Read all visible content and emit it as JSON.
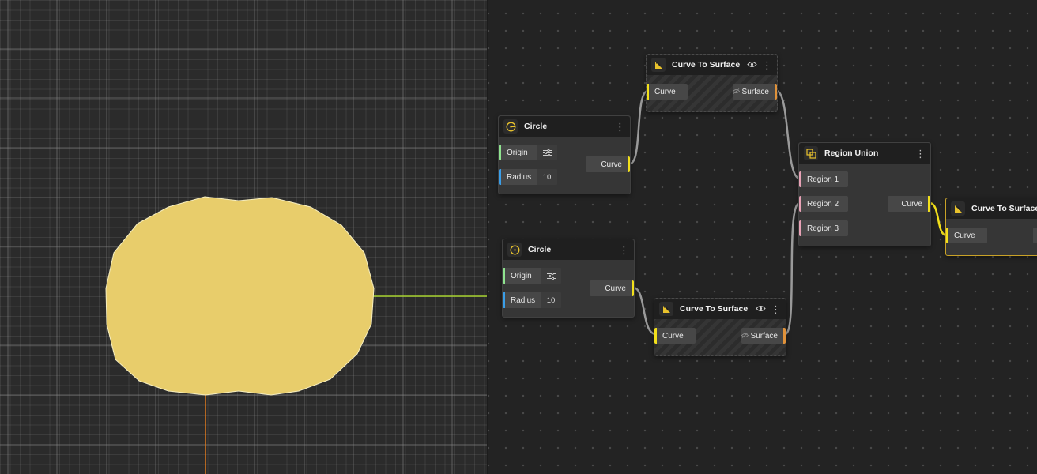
{
  "colors": {
    "shape_fill": "#e8cd6b",
    "x_axis": "#a6d22f",
    "y_axis": "#e07a1e",
    "port_origin": "#8fe38f",
    "port_radius": "#3a9ee8",
    "port_curve": "#f2e01b",
    "port_region": "#e8a2b6",
    "port_surface": "#e0923a",
    "wire_gray": "#9a9a9a",
    "wire_yellow": "#f2e01b"
  },
  "nodes": {
    "circle_1": {
      "title": "Circle",
      "icon": "circle-icon",
      "origin_label": "Origin",
      "radius_label": "Radius",
      "radius_value": "10",
      "output_label": "Curve"
    },
    "circle_2": {
      "title": "Circle",
      "icon": "circle-icon",
      "origin_label": "Origin",
      "radius_label": "Radius",
      "radius_value": "10",
      "output_label": "Curve"
    },
    "curve_to_surface_1": {
      "title": "Curve To Surface",
      "icon": "curve-to-surface-icon",
      "input_label": "Curve",
      "output_label": "Surface"
    },
    "curve_to_surface_2": {
      "title": "Curve To Surface",
      "icon": "curve-to-surface-icon",
      "input_label": "Curve",
      "output_label": "Surface"
    },
    "region_union": {
      "title": "Region Union",
      "icon": "region-union-icon",
      "inputs": [
        "Region 1",
        "Region 2",
        "Region 3"
      ],
      "output_label": "Curve"
    },
    "curve_to_surface_3": {
      "title": "Curve To Surface",
      "icon": "curve-to-surface-icon",
      "input_label": "Curve"
    }
  }
}
